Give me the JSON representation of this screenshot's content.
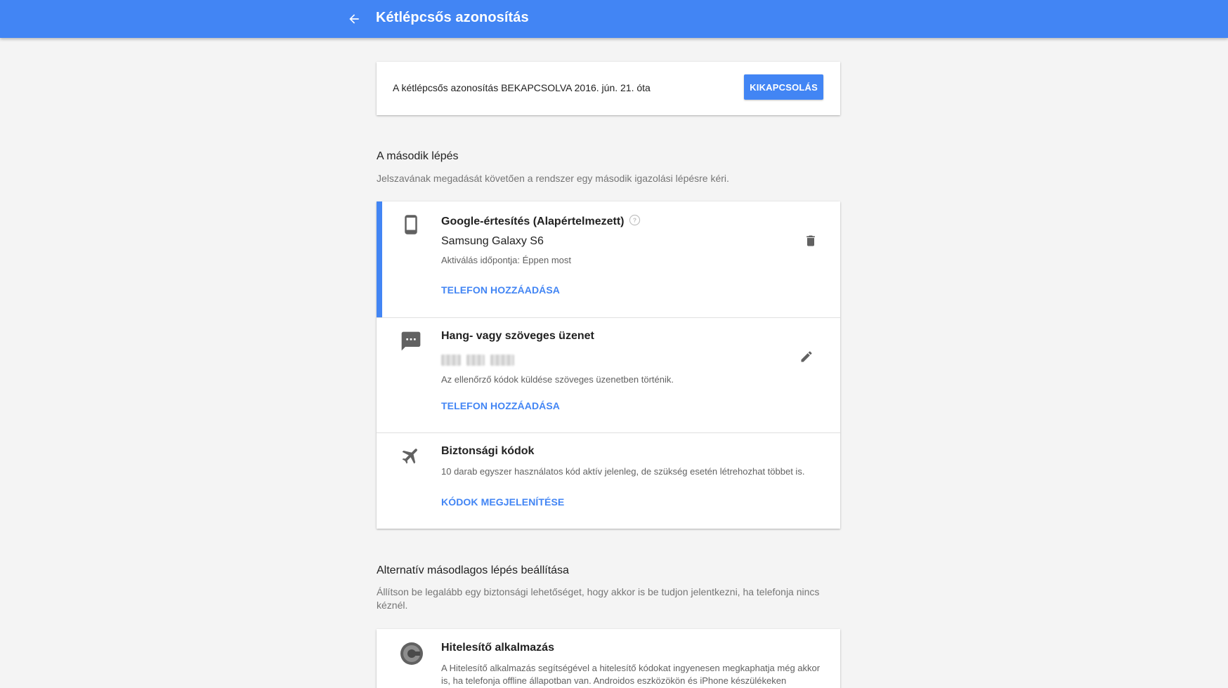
{
  "header": {
    "title": "Kétlépcsős azonosítás",
    "back_icon": "arrow-back-icon",
    "color": "#4285f4"
  },
  "status": {
    "text": "A kétlépcsős azonosítás BEKAPCSOLVA 2016. jún. 21. óta",
    "button_label": "KIKAPCSOLÁS"
  },
  "second_step": {
    "title": "A második lépés",
    "description": "Jelszavának megadását követően a rendszer egy második igazolási lépésre kéri."
  },
  "methods": {
    "google_prompt": {
      "icon": "smartphone-icon",
      "title": "Google-értesítés (Alapértelmezett)",
      "help_icon": "help-circle-icon",
      "device": "Samsung Galaxy S6",
      "activated": "Aktiválás időpontja: Éppen most",
      "link": "TELEFON HOZZÁADÁSA",
      "action_icon": "delete-icon"
    },
    "voice_sms": {
      "icon": "sms-icon",
      "title": "Hang- vagy szöveges üzenet",
      "description": "Az ellenőrző kódok küldése szöveges üzenetben történik.",
      "link": "TELEFON HOZZÁADÁSA",
      "action_icon": "edit-icon"
    },
    "backup_codes": {
      "icon": "airplane-icon",
      "title": "Biztonsági kódok",
      "description": "10 darab egyszer használatos kód aktív jelenleg, de szükség esetén létrehozhat többet is.",
      "link": "KÓDOK MEGJELENÍTÉSE"
    }
  },
  "alternative": {
    "title": "Alternatív másodlagos lépés beállítása",
    "description": "Állítson be legalább egy biztonsági lehetőséget, hogy akkor is be tudjon jelentkezni, ha telefonja nincs kéznél."
  },
  "authenticator": {
    "icon": "authenticator-icon",
    "title": "Hitelesítő alkalmazás",
    "description": "A Hitelesítő alkalmazás segítségével a hitelesítő kódokat ingyenesen megkaphatja még akkor is, ha telefonja offline állapotban van. Androidos eszközökön és iPhone készülékeken"
  }
}
